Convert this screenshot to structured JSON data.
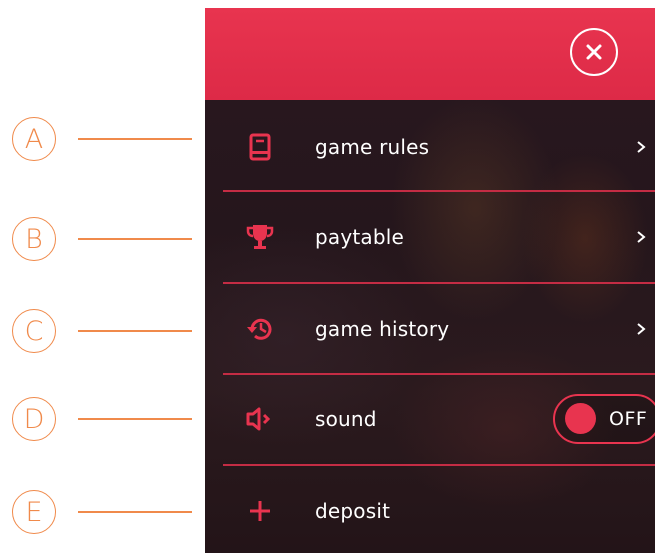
{
  "callouts": [
    "A",
    "B",
    "C",
    "D",
    "E"
  ],
  "menu": {
    "items": [
      {
        "label": "game rules",
        "icon": "book-icon",
        "has_chevron": true
      },
      {
        "label": "paytable",
        "icon": "trophy-icon",
        "has_chevron": true
      },
      {
        "label": "game history",
        "icon": "history-clock-icon",
        "has_chevron": true
      },
      {
        "label": "sound",
        "icon": "speaker-icon",
        "toggle": "OFF"
      },
      {
        "label": "deposit",
        "icon": "plus-icon"
      }
    ]
  },
  "colors": {
    "accent": "#e8344f",
    "callout": "#f08a4b",
    "panel_bg": "#25161c"
  }
}
